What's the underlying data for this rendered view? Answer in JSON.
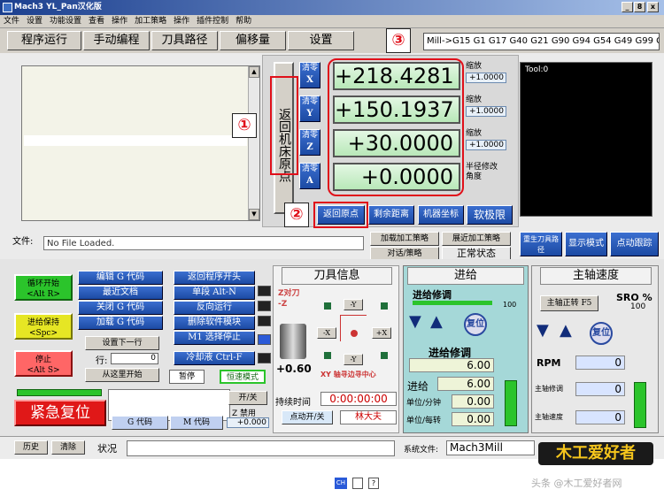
{
  "window": {
    "title": "Mach3 YL_Pan汉化版",
    "min": "_",
    "restore": "8",
    "close": "x"
  },
  "menu": [
    "文件",
    "设置",
    "功能设置",
    "查看",
    "操作",
    "加工策略",
    "操作",
    "插件控制",
    "帮助"
  ],
  "tabs": [
    "程序运行",
    "手动编程",
    "刀具路径",
    "偏移量",
    "设置"
  ],
  "mdi_text": "Mill->G15  G1 G17 G40 G21 G90 G94 G54 G49 G99 G64",
  "annotations": {
    "one": "①",
    "two": "②",
    "three": "③"
  },
  "return_home_vertical": "返回机床原点",
  "axes": [
    {
      "zero_label": "清零",
      "axis": "X",
      "value": "+218.4281",
      "scale_label": "缩放",
      "scale": "+1.0000"
    },
    {
      "zero_label": "清零",
      "axis": "Y",
      "value": "+150.1937",
      "scale_label": "缩放",
      "scale": "+1.0000"
    },
    {
      "zero_label": "清零",
      "axis": "Z",
      "value": "+30.0000",
      "scale_label": "缩放",
      "scale": "+1.0000"
    },
    {
      "zero_label": "清零",
      "axis": "A",
      "value": "+0.0000",
      "scale_label": "半径修改",
      "scale": "角度"
    }
  ],
  "coord_buttons": [
    "返回原点",
    "剩余距离",
    "机器坐标",
    "软极限"
  ],
  "toolpath_label": "Tool:0",
  "file_label": "文件:",
  "file_value": "No File Loaded.",
  "strategy_buttons": [
    "加载加工策略",
    "展近加工策略",
    "对话/策略",
    "正常状态"
  ],
  "toolpath_buttons": {
    "regen": "重生刀具路径",
    "display": "显示模式",
    "follow": "点动跟踪"
  },
  "run_buttons": {
    "cycle_start": "循环开始\n<Alt R>",
    "feed_hold": "进给保持\n<Spc>",
    "stop": "停止\n<Alt S>",
    "edit": "编辑 G 代码",
    "recent": "最近文档",
    "close": "关闭 G 代码",
    "load": "加载 G 代码",
    "set_next": "设置下一行",
    "line_label": "行:",
    "line_value": "0",
    "run_from": "从这里开始",
    "rewind": "返回程序开头",
    "single": "单段 Alt-N",
    "reverse": "反向运行",
    "block_delete": "删除软件模块",
    "m1": "M1 选择停止",
    "flood": "冷却液 Ctrl-F",
    "pause": "暂停",
    "constant": "恒速模式"
  },
  "tool_panel": {
    "title": "刀具信息",
    "z_probe": "Z对刀",
    "z_minus": "Z对刀\n-Z",
    "ymove": "-Y",
    "xminus": "-X",
    "xplus": "+X",
    "ymin": "-Y",
    "xy_center": "XY 轴寻边寻中心",
    "value": "+0.60",
    "jog_label": "开/关",
    "z_disable": "Z 禁用",
    "z_value": "+0.000",
    "hold_label": "持续时间",
    "hold_time": "0:00:00:00",
    "jog_btn": "点动开/关",
    "author": "林大夫"
  },
  "feed_panel": {
    "title": "进给",
    "override_label": "进给修调",
    "override_max": "100",
    "reset": "复位",
    "feed_override_label": "进给修调",
    "feed_value": "6.00",
    "feed_label": "进给",
    "feed_value2": "6.00",
    "units_min": "单位/分钟",
    "units_min_val": "0.00",
    "units_rev": "单位/每转",
    "units_rev_val": "0.00"
  },
  "spindle_panel": {
    "title": "主轴速度",
    "sro": "SRO %",
    "sro_val": "100",
    "cw": "主轴正转 F5",
    "reset": "复位",
    "rpm_label": "RPM",
    "rpm": "0",
    "spindle_override": "主轴修调",
    "override_val": "0",
    "spindle_speed": "主轴速度",
    "speed_val": "0"
  },
  "estop": "紧急复位",
  "gcodes_btn": "G 代码",
  "mcodes_btn": "M 代码",
  "history": "历史",
  "clear": "清除",
  "status_label": "状况",
  "profile_label": "系统文件:",
  "profile_value": "Mach3Mill",
  "watermark": "头条 @木工爱好者网"
}
